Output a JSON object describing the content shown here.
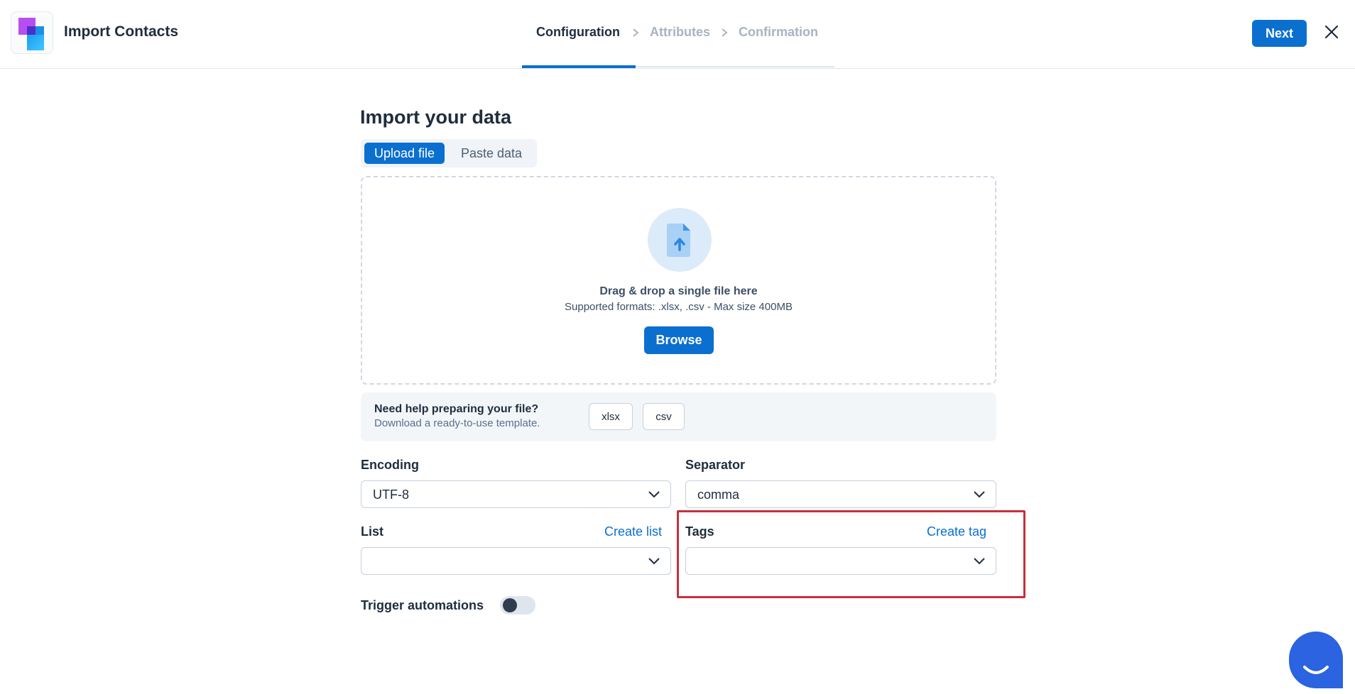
{
  "header": {
    "app_title": "Import Contacts",
    "steps": [
      {
        "label": "Configuration",
        "state": "active"
      },
      {
        "label": "Attributes",
        "state": "inactive"
      },
      {
        "label": "Confirmation",
        "state": "inactive"
      }
    ],
    "next_label": "Next"
  },
  "main": {
    "title": "Import your data",
    "tabs": [
      {
        "label": "Upload file",
        "selected": true
      },
      {
        "label": "Paste data",
        "selected": false
      }
    ],
    "dropzone": {
      "title": "Drag & drop a single file here",
      "subtitle": "Supported formats: .xlsx, .csv - Max size 400MB",
      "browse_label": "Browse"
    },
    "help": {
      "title": "Need help preparing your file?",
      "subtitle": "Download a ready-to-use template.",
      "templates": [
        "xlsx",
        "csv"
      ]
    },
    "fields": {
      "encoding": {
        "label": "Encoding",
        "value": "UTF-8"
      },
      "separator": {
        "label": "Separator",
        "value": "comma"
      },
      "list": {
        "label": "List",
        "link": "Create list",
        "value": ""
      },
      "tags": {
        "label": "Tags",
        "link": "Create tag",
        "value": ""
      }
    },
    "trigger_automations": {
      "label": "Trigger automations",
      "enabled": false
    }
  },
  "colors": {
    "accent": "#0b6fcf",
    "highlight": "#c8303a",
    "chat_widget": "#2b63e0"
  }
}
